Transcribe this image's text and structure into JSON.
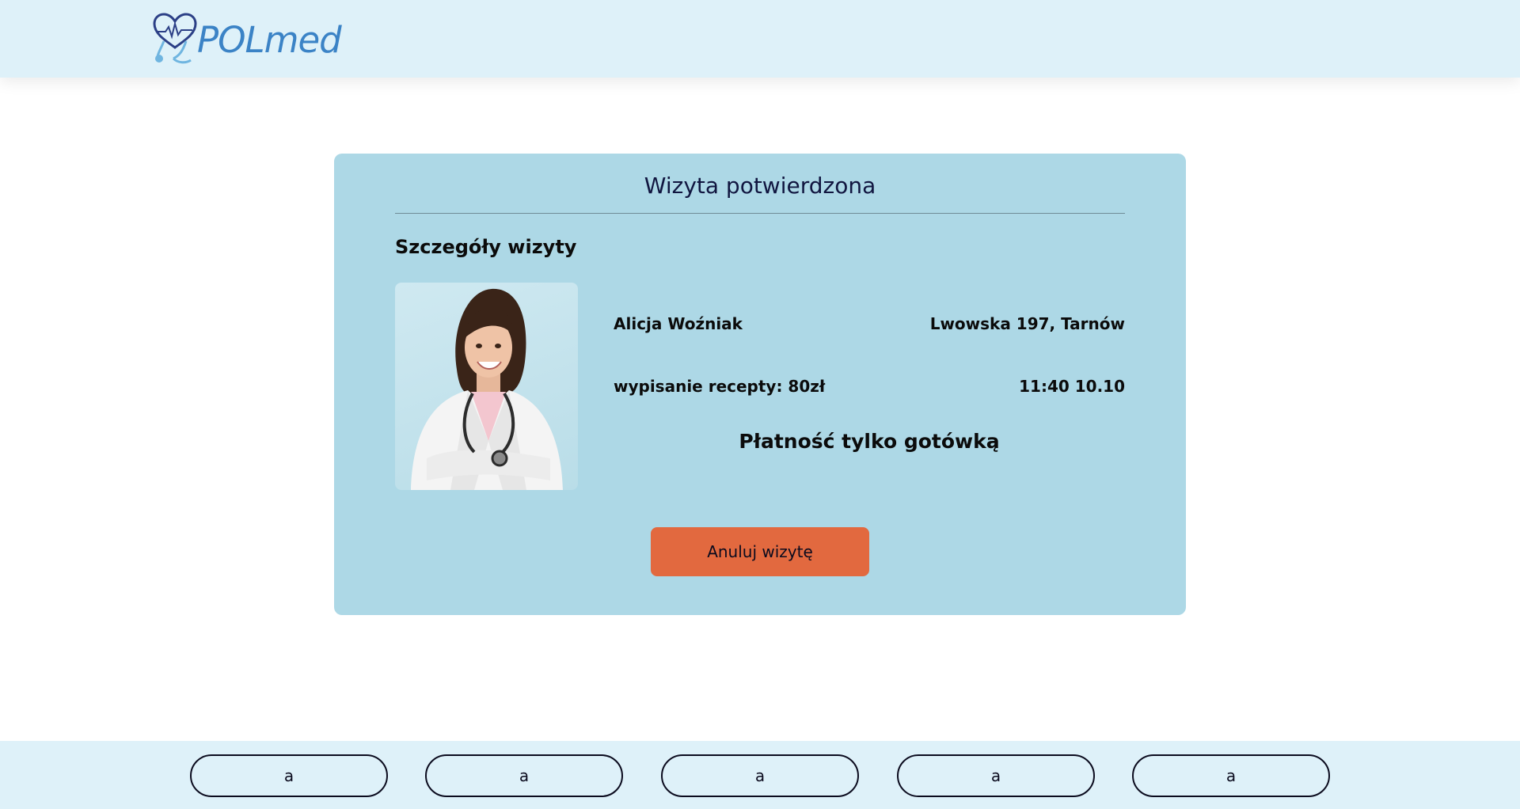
{
  "header": {
    "logo_text": "POLmed",
    "logo_icon": "heart-stethoscope-icon",
    "brand_color": "#3b83c6"
  },
  "visit_card": {
    "title": "Wizyta potwierdzona",
    "section_title": "Szczegóły wizyty",
    "doctor_name": "Alicja Woźniak",
    "address": "Lwowska 197, Tarnów",
    "service": "wypisanie recepty: 80zł",
    "datetime": "11:40 10.10",
    "payment_note": "Płatność tylko gotówką",
    "cancel_label": "Anuluj wizytę",
    "cancel_color": "#e2693f",
    "card_color": "#add8e6"
  },
  "footer": {
    "buttons": [
      "a",
      "a",
      "a",
      "a",
      "a"
    ]
  }
}
